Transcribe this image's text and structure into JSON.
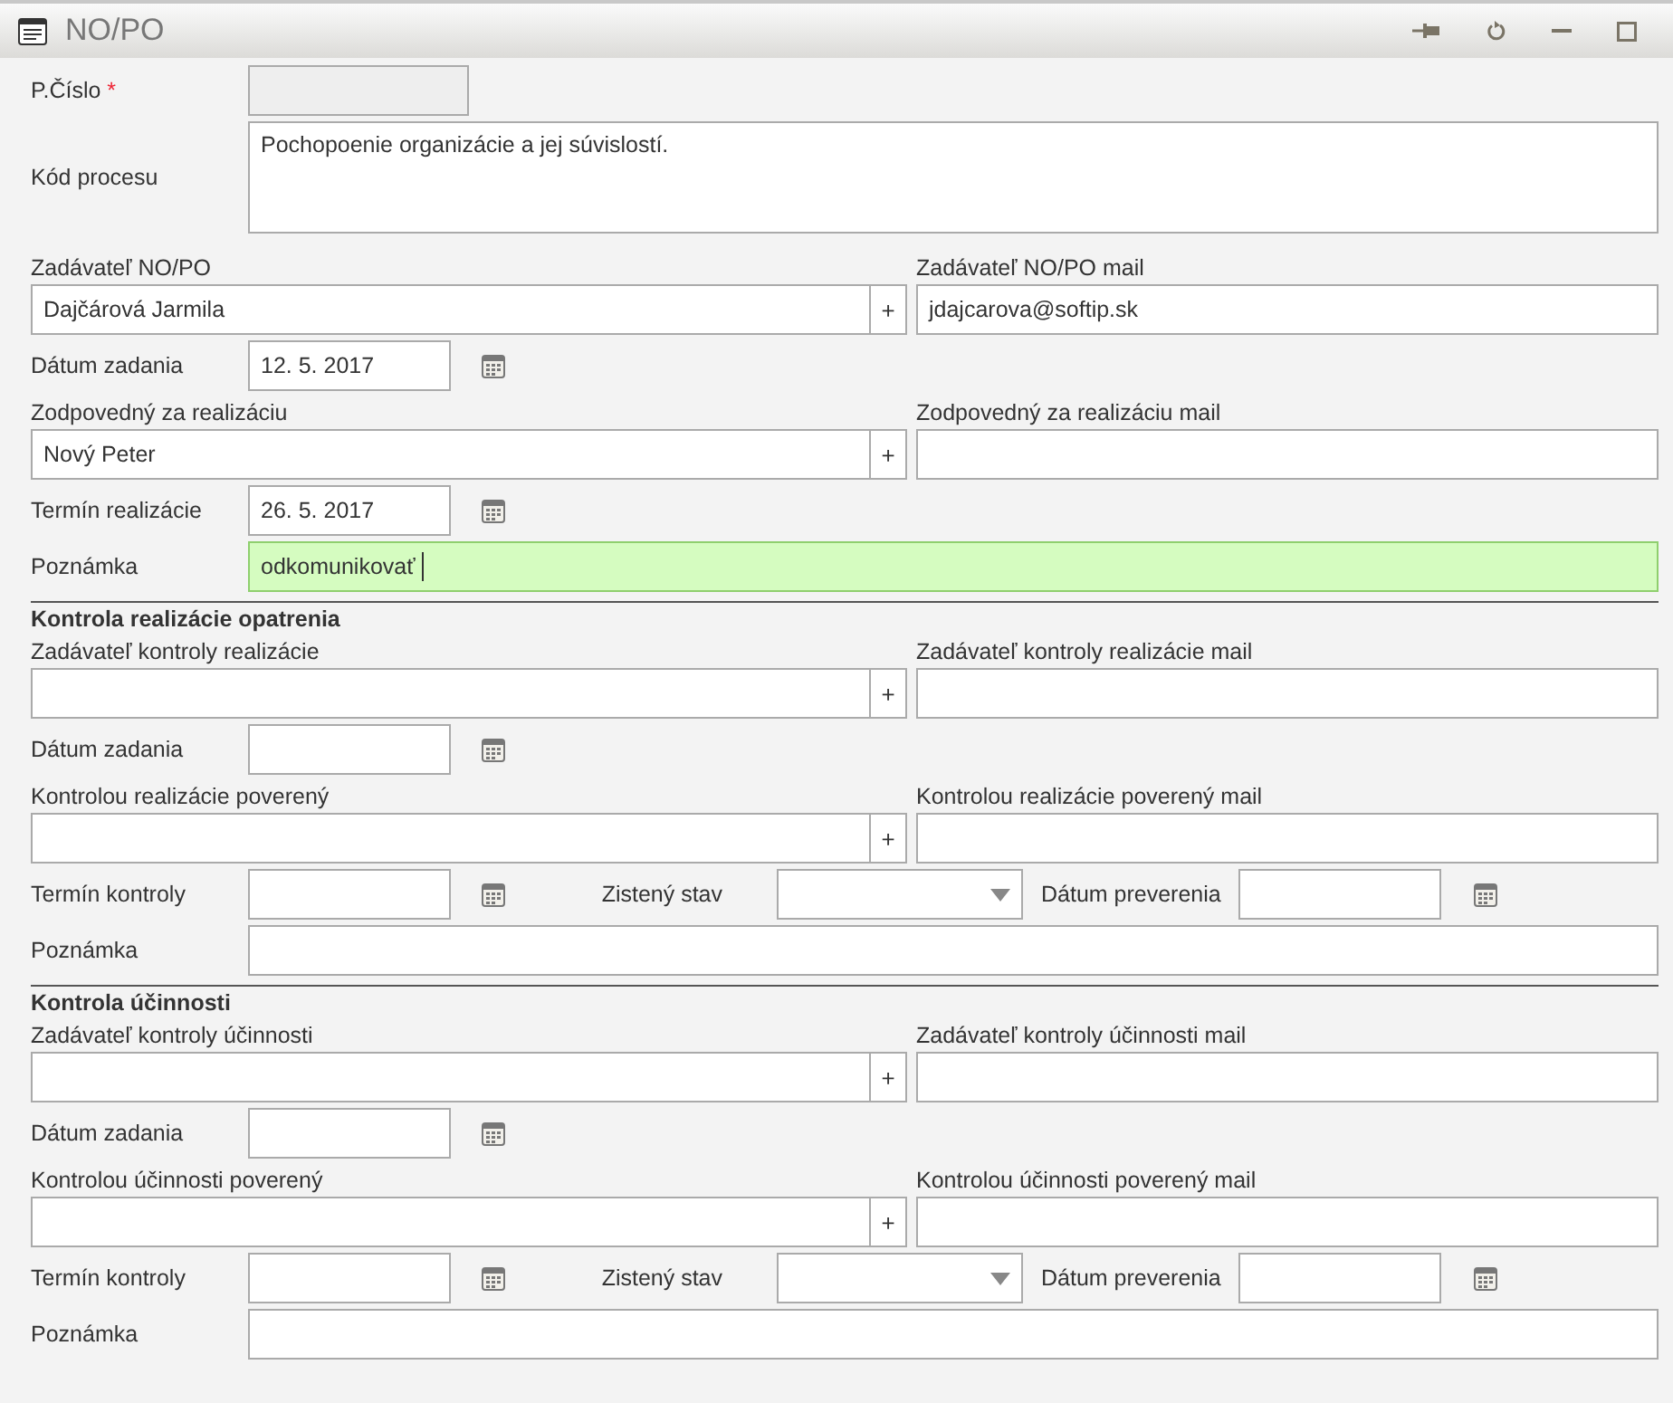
{
  "window": {
    "title": "NO/PO"
  },
  "rows": [
    {
      "kind": "number",
      "label": "P.Číslo",
      "required_mark": "*",
      "disabled": true
    },
    {
      "kind": "textarea",
      "label": "Kód procesu",
      "value": "Pochopoenie organizácie a jej súvislostí."
    },
    {
      "kind": "person",
      "label": "Zadávateľ NO/PO",
      "value": "Dajčárová Jarmila",
      "add": "+",
      "mail_label": "Zadávateľ NO/PO mail",
      "mail_value": "jdajcarova@softip.sk"
    },
    {
      "kind": "date",
      "label": "Dátum zadania",
      "value": "12. 5. 2017"
    },
    {
      "kind": "person",
      "label": "Zodpovedný za realizáciu",
      "value": "Nový Peter",
      "add": "+",
      "mail_label": "Zodpovedný za realizáciu mail"
    },
    {
      "kind": "date",
      "label": "Termín realizácie",
      "value": "26. 5. 2017"
    },
    {
      "kind": "note",
      "label": "Poznámka",
      "value": "odkomunikovať",
      "focused": true
    },
    {
      "kind": "heading",
      "title": "Kontrola realizácie opatrenia"
    },
    {
      "kind": "person",
      "label": "Zadávateľ kontroly realizácie",
      "add": "+",
      "mail_label": "Zadávateľ kontroly realizácie mail"
    },
    {
      "kind": "date",
      "label": "Dátum zadania"
    },
    {
      "kind": "person",
      "label": "Kontrolou realizácie poverený",
      "add": "+",
      "mail_label": "Kontrolou realizácie poverený mail"
    },
    {
      "kind": "check",
      "label": "Termín kontroly",
      "state_label": "Zistený stav",
      "verify_label": "Dátum preverenia"
    },
    {
      "kind": "note",
      "label": "Poznámka",
      "focused": false
    },
    {
      "kind": "heading",
      "title": "Kontrola účinnosti"
    },
    {
      "kind": "person",
      "label": "Zadávateľ kontroly účinnosti",
      "add": "+",
      "mail_label": "Zadávateľ kontroly účinnosti mail"
    },
    {
      "kind": "date",
      "label": "Dátum zadania"
    },
    {
      "kind": "person",
      "label": "Kontrolou účinnosti poverený",
      "add": "+",
      "mail_label": "Kontrolou účinnosti poverený mail"
    },
    {
      "kind": "check",
      "label": "Termín kontroly",
      "state_label": "Zistený stav",
      "verify_label": "Dátum preverenia"
    },
    {
      "kind": "note",
      "label": "Poznámka",
      "focused": false
    }
  ]
}
